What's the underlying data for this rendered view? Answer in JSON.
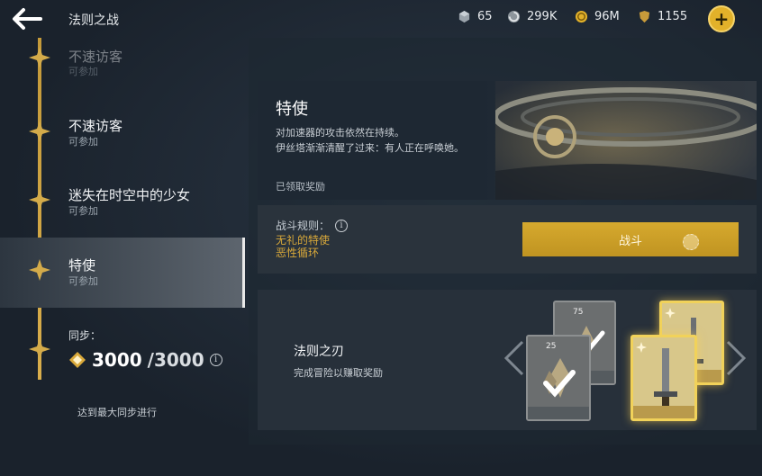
{
  "header": {
    "title": "法则之战",
    "currencies": [
      {
        "icon": "cube-icon",
        "value": "65"
      },
      {
        "icon": "swirl-coin-icon",
        "value": "299K"
      },
      {
        "icon": "gold-coin-icon",
        "value": "96M"
      },
      {
        "icon": "shield-token-icon",
        "value": "1155"
      }
    ]
  },
  "stages": [
    {
      "name": "不速访客",
      "status": "可参加"
    },
    {
      "name": "不速访客",
      "status": "可参加"
    },
    {
      "name": "迷失在时空中的少女",
      "status": "可参加"
    },
    {
      "name": "特使",
      "status": "可参加"
    }
  ],
  "sync": {
    "label": "同步：",
    "current": "3000",
    "max": "/3000",
    "status": "达到最大同步进行"
  },
  "mission": {
    "title": "特使",
    "description": [
      "对加速器的攻击依然在持续。",
      "伊丝塔渐渐清醒了过来：有人正在呼唤她。"
    ],
    "reward_status": "已领取奖励"
  },
  "battle": {
    "rules_label": "战斗规则：",
    "rules": [
      "无礼的特使",
      "恶性循环"
    ],
    "button_label": "战斗"
  },
  "reward": {
    "title": "法则之刃",
    "description": "完成冒险以赚取奖励",
    "cards": [
      {
        "count": "25",
        "style": "grey"
      },
      {
        "count": "75",
        "style": "grey"
      },
      {
        "count": "",
        "style": "gold"
      },
      {
        "count": "",
        "style": "gold"
      }
    ]
  },
  "colors": {
    "accent_gold": "#d6a92e",
    "rule_text": "#d9a93a",
    "background": "#1c2530"
  }
}
